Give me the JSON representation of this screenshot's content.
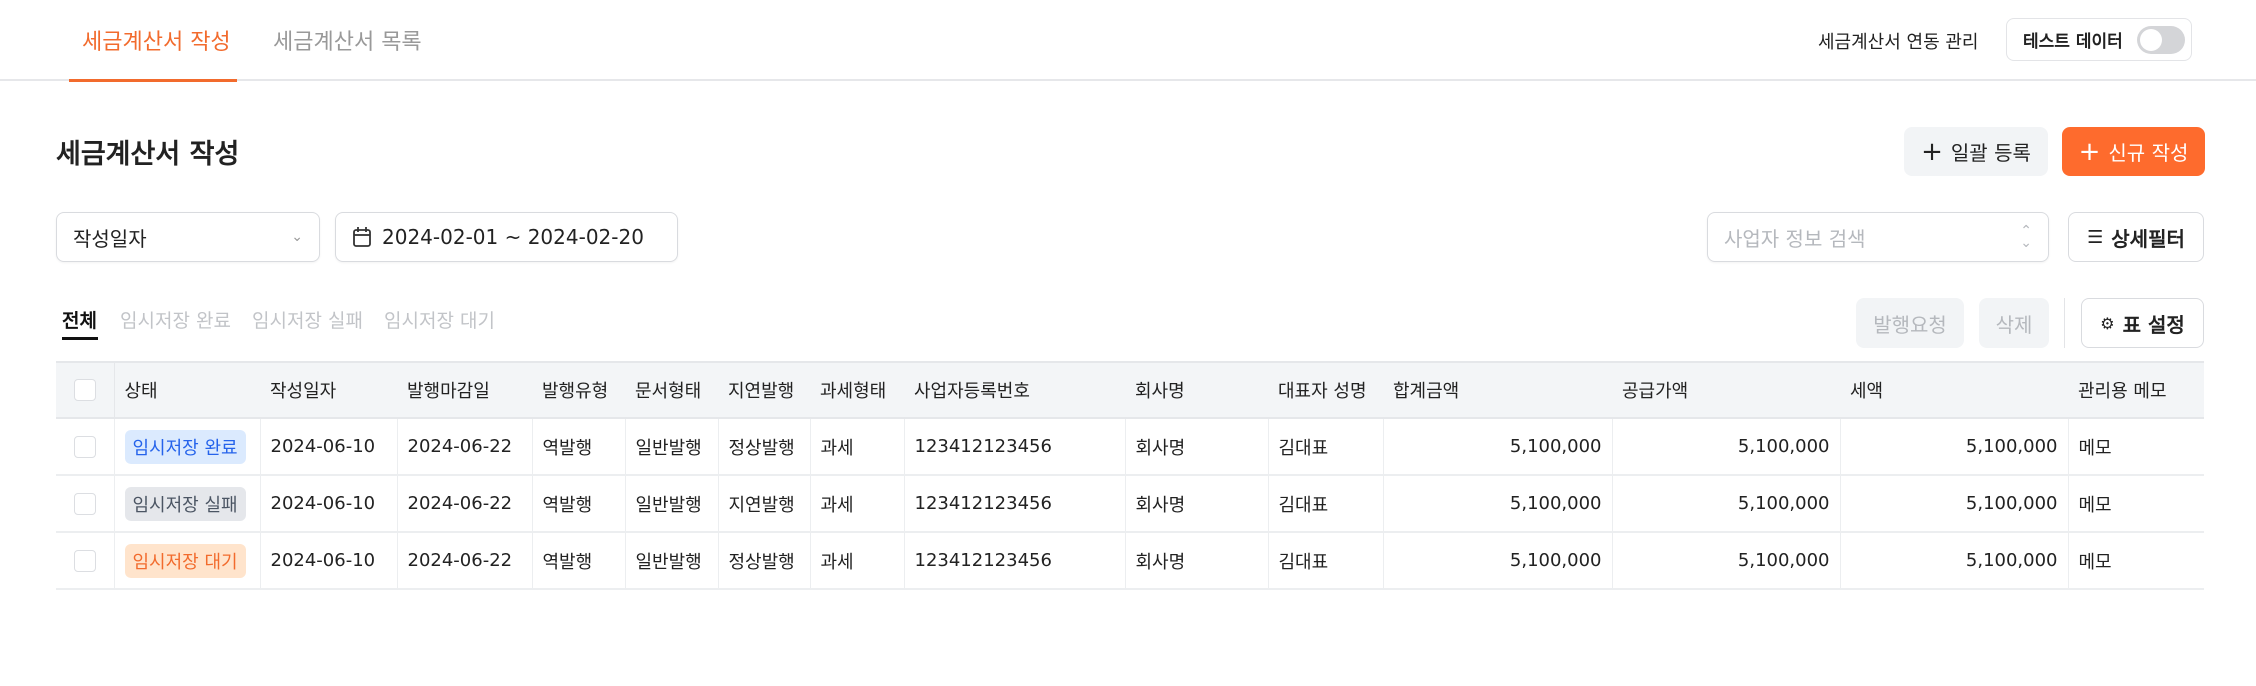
{
  "nav": {
    "tabs": [
      {
        "label": "세금계산서 작성",
        "active": true
      },
      {
        "label": "세금계산서 목록",
        "active": false
      }
    ],
    "sync_label": "세금계산서 연동 관리",
    "test_data_label": "테스트 데이터",
    "test_data_on": false
  },
  "page": {
    "title": "세금계산서 작성",
    "bulk_label": "일괄 등록",
    "new_label": "신규 작성"
  },
  "filters": {
    "date_type": "작성일자",
    "date_range": "2024-02-01 ~ 2024-02-20",
    "search_placeholder": "사업자 정보 검색",
    "detail_filter_label": "상세필터"
  },
  "subtabs": [
    {
      "label": "전체",
      "active": true
    },
    {
      "label": "임시저장 완료"
    },
    {
      "label": "임시저장 실패"
    },
    {
      "label": "임시저장 대기"
    }
  ],
  "actions": {
    "issue_label": "발행요청",
    "delete_label": "삭제",
    "table_settings_label": "표 설정"
  },
  "colors": {
    "accent": "#fe6b2d",
    "badge_done_bg": "#dbeafe",
    "badge_done_fg": "#2563eb",
    "badge_fail_bg": "#e5e7eb",
    "badge_fail_fg": "#4b5563",
    "badge_wait_bg": "#ffe4cc",
    "badge_wait_fg": "#f26b2d"
  },
  "table": {
    "columns": [
      "상태",
      "작성일자",
      "발행마감일",
      "발행유형",
      "문서형태",
      "지연발행",
      "과세형태",
      "사업자등록번호",
      "회사명",
      "대표자 성명",
      "합계금액",
      "공급가액",
      "세액",
      "관리용 메모"
    ],
    "rows": [
      [
        "임시저장 완료",
        "2024-06-10",
        "2024-06-22",
        "역발행",
        "일반발행",
        "정상발행",
        "과세",
        "123412123456",
        "회사명",
        "김대표",
        "5,100,000",
        "5,100,000",
        "5,100,000",
        "메모"
      ],
      [
        "임시저장 실패",
        "2024-06-10",
        "2024-06-22",
        "역발행",
        "일반발행",
        "지연발행",
        "과세",
        "123412123456",
        "회사명",
        "김대표",
        "5,100,000",
        "5,100,000",
        "5,100,000",
        "메모"
      ],
      [
        "임시저장 대기",
        "2024-06-10",
        "2024-06-22",
        "역발행",
        "일반발행",
        "정상발행",
        "과세",
        "123412123456",
        "회사명",
        "김대표",
        "5,100,000",
        "5,100,000",
        "5,100,000",
        "메모"
      ]
    ]
  }
}
